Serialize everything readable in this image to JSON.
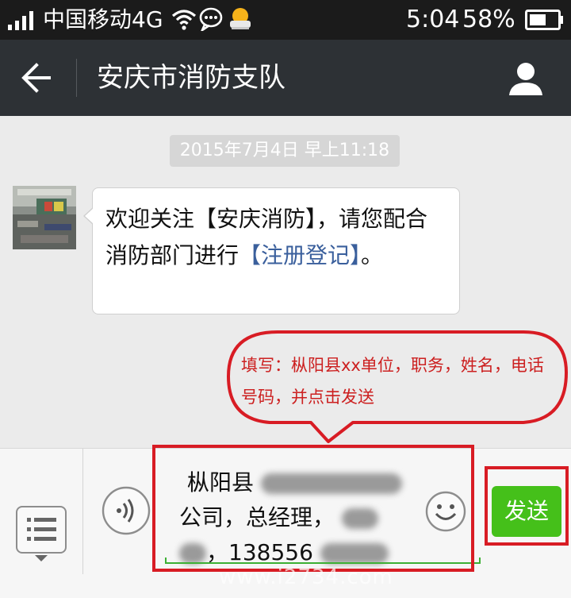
{
  "status_bar": {
    "carrier": "中国移动4G",
    "time": "5:04",
    "battery": "58%",
    "icons": [
      "signal-icon",
      "wifi-icon",
      "message-icon",
      "weather-icon",
      "battery-icon"
    ]
  },
  "nav": {
    "title": "安庆市消防支队",
    "back_icon": "back-arrow-icon",
    "profile_icon": "profile-icon"
  },
  "chat": {
    "timestamp": "2015年7月4日 早上11:18",
    "message": {
      "text_before": "欢迎关注【安庆消防】，请您配合消防部门进行",
      "link_text": "【注册登记】",
      "text_after": "。"
    }
  },
  "annotation": {
    "text": "填写：枞阳县xx单位，职务，姓名，电话号码，并点击发送"
  },
  "input": {
    "line1": "枞阳县",
    "line2": "公司，总经理，",
    "line3": "，138556",
    "send_label": "发送"
  },
  "watermark": "www.i2734.com",
  "colors": {
    "accent_red": "#d81c24",
    "send_green": "#45c01a",
    "nav_bg": "#2d3135",
    "link_blue": "#3a5f9c"
  }
}
